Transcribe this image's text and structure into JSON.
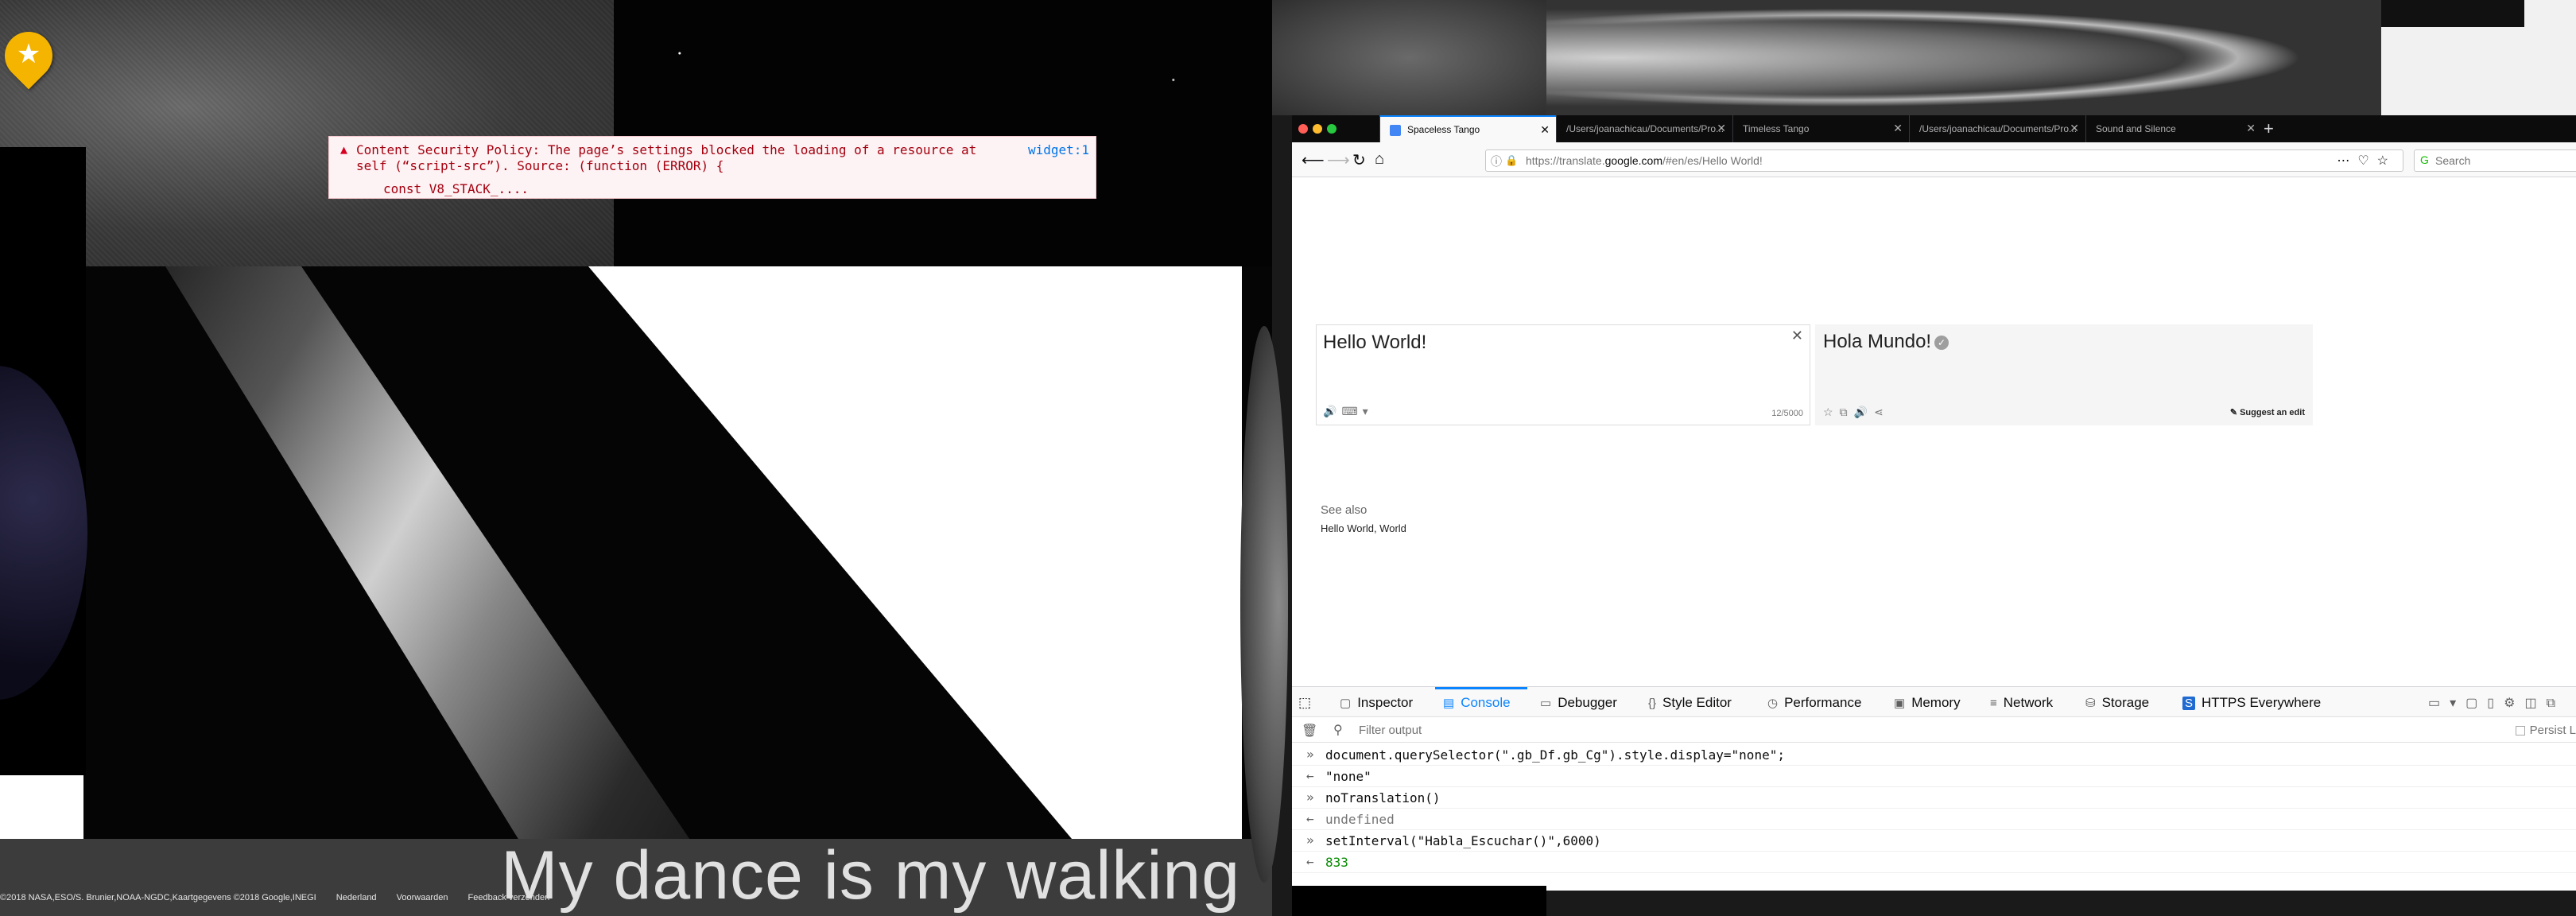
{
  "left_scene": {
    "csp_error": {
      "message": "Content Security Policy: The page’s settings blocked the loading of a resource at self (“script-src”). Source: (function (ERROR) {",
      "source": "widget:1",
      "detail": "const V8_STACK_...."
    },
    "map_attribution": [
      "©2018 NASA,ESO/S. Brunier,NOAA-NGDC,Kaartgegevens ©2018 Google,INEGI",
      "Nederland",
      "Voorwaarden",
      "Feedback verzenden"
    ],
    "lyric": "My dance is my walking"
  },
  "browser": {
    "tabs": [
      {
        "label": "Spaceless Tango",
        "active": true
      },
      {
        "label": "/Users/joanachicau/Documents/Pro...",
        "active": false
      },
      {
        "label": "Timeless Tango",
        "active": false
      },
      {
        "label": "/Users/joanachicau/Documents/Pro...",
        "active": false
      },
      {
        "label": "Sound and Silence",
        "active": false
      }
    ],
    "url": {
      "prefix": "https://translate.",
      "host": "google.com",
      "path": "/#en/es/Hello World!"
    },
    "search_placeholder": "Search"
  },
  "translate": {
    "source_text": "Hello World!",
    "char_count": "12/5000",
    "translation": "Hola Mundo!",
    "suggest_edit": "Suggest an edit",
    "see_also_title": "See also",
    "see_also_items": "Hello World, World"
  },
  "devtools": {
    "tabs": [
      "Inspector",
      "Console",
      "Debugger",
      "Style Editor",
      "Performance",
      "Memory",
      "Network",
      "Storage",
      "HTTPS Everywhere"
    ],
    "active_tab": "Console",
    "filter_placeholder": "Filter output",
    "persist_label": "Persist L",
    "console_lines": [
      {
        "type": "input",
        "text": "document.querySelector(\".gb_Df.gb_Cg\").style.display=\"none\";"
      },
      {
        "type": "output",
        "text": "\"none\""
      },
      {
        "type": "input",
        "text": "noTranslation()"
      },
      {
        "type": "undefined",
        "text": "undefined"
      },
      {
        "type": "input",
        "text": "setInterval(\"Habla_Escuchar()\",6000)"
      },
      {
        "type": "number",
        "text": "833"
      }
    ]
  },
  "colors": {
    "accent": "#0a84ff",
    "error_red": "#a4000f",
    "pin_yellow": "#f5b400"
  }
}
